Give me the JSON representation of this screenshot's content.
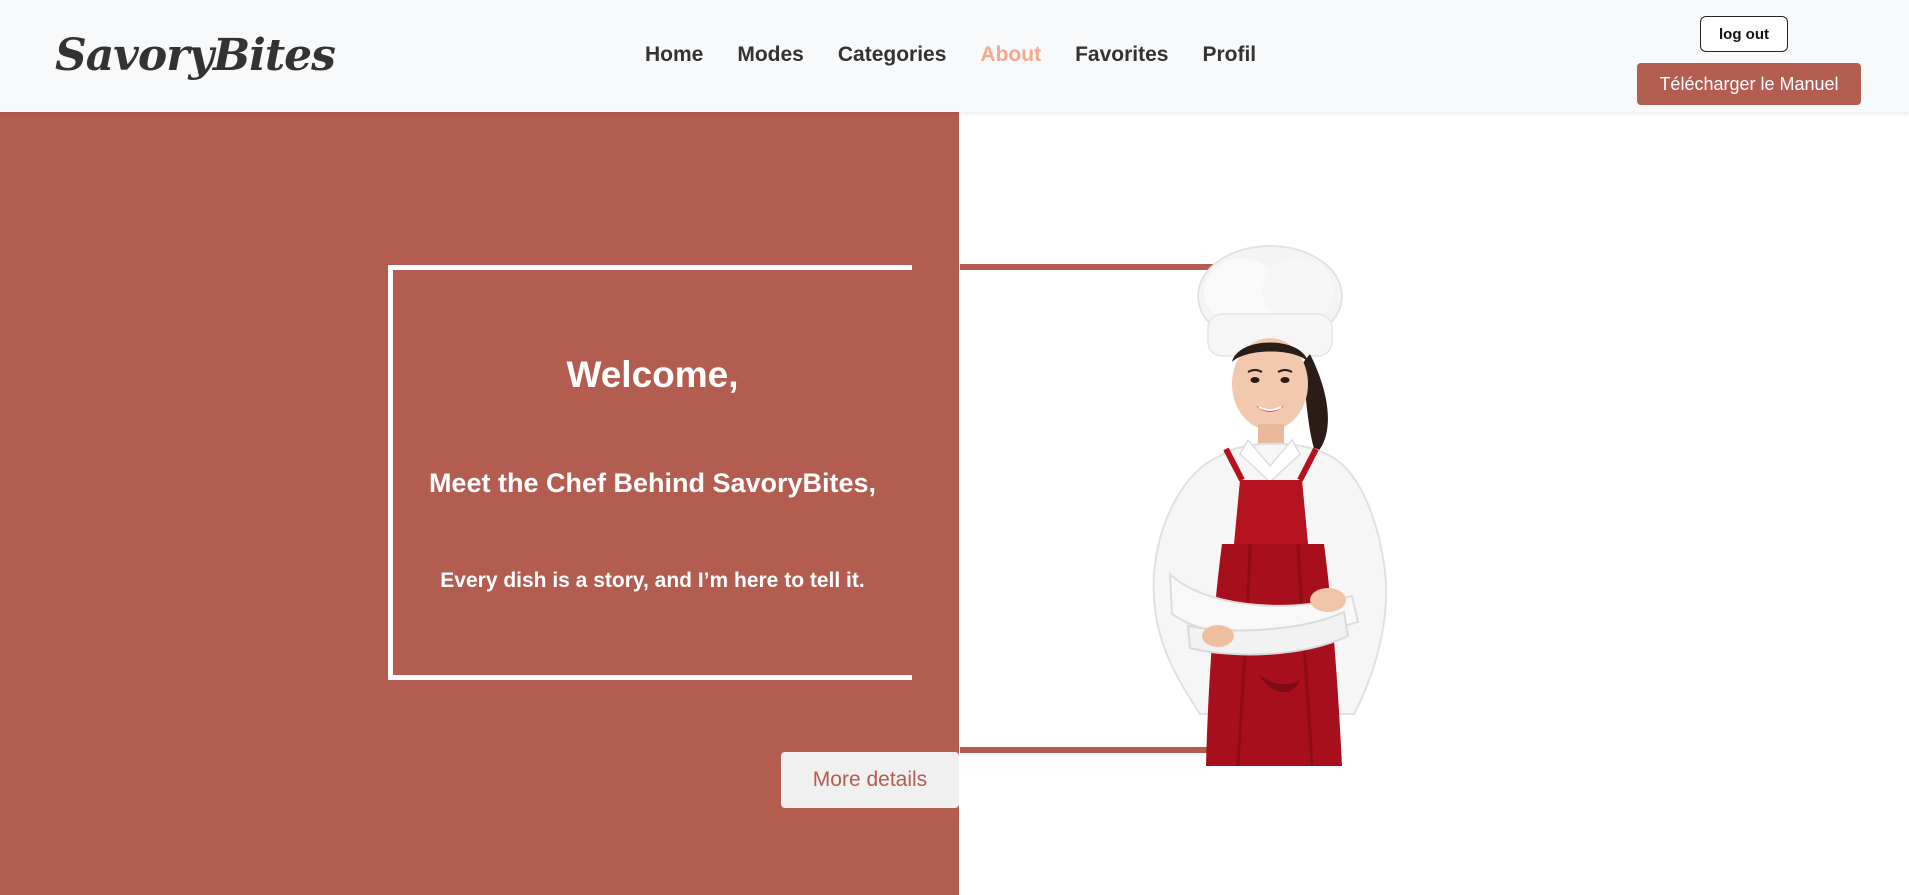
{
  "header": {
    "brand": "SavoryBites",
    "nav": [
      {
        "label": "Home",
        "active": false
      },
      {
        "label": "Modes",
        "active": false
      },
      {
        "label": "Categories",
        "active": false
      },
      {
        "label": "About",
        "active": true
      },
      {
        "label": "Favorites",
        "active": false
      },
      {
        "label": "Profil",
        "active": false
      }
    ],
    "logout_label": "log out",
    "download_label": "Télécharger le Manuel"
  },
  "hero": {
    "welcome": "Welcome,",
    "subtitle": "Meet the Chef Behind SavoryBites,",
    "tagline": "Every dish is a story, and I’m here to tell it.",
    "more_label": "More details",
    "image_icon": "chef-portrait"
  },
  "colors": {
    "brand_accent": "#b35c50",
    "nav_active": "#f6a88a",
    "navbar_bg": "#f8f9fa",
    "apron_red": "#b5111f"
  }
}
